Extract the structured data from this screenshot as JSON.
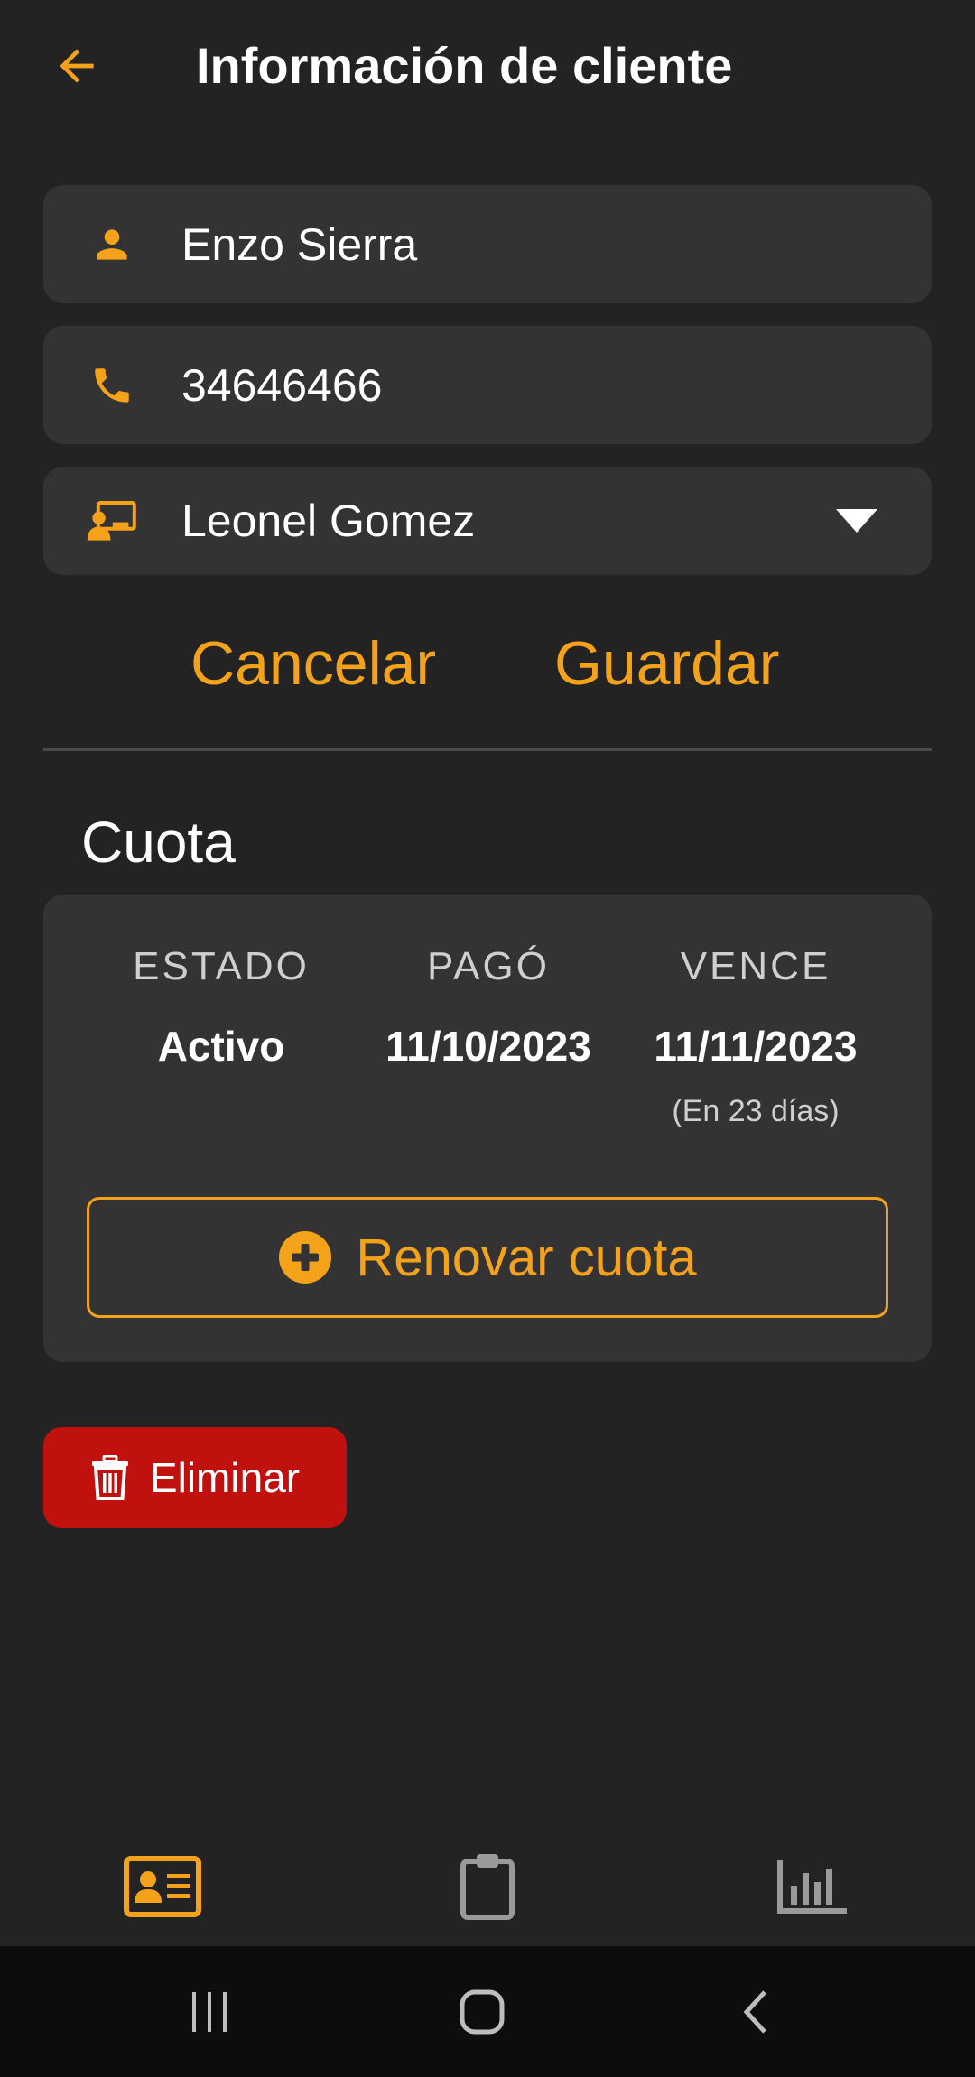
{
  "header": {
    "title": "Información de cliente",
    "back_icon": "arrow-left-icon"
  },
  "form": {
    "name": {
      "icon": "person-icon",
      "value": "Enzo Sierra"
    },
    "phone": {
      "icon": "phone-icon",
      "value": "34646466"
    },
    "trainer": {
      "icon": "trainer-icon",
      "selected": "Leonel Gomez"
    }
  },
  "actions": {
    "cancel_label": "Cancelar",
    "save_label": "Guardar"
  },
  "cuota": {
    "title": "Cuota",
    "estado_header": "ESTADO",
    "pago_header": "PAGÓ",
    "vence_header": "VENCE",
    "estado_value": "Activo",
    "pago_value": "11/10/2023",
    "vence_value": "11/11/2023",
    "vence_note": "(En 23 días)",
    "renew_label": "Renovar cuota"
  },
  "delete": {
    "label": "Eliminar"
  },
  "tabs": [
    {
      "icon": "id-card-icon",
      "active": true
    },
    {
      "icon": "clipboard-icon",
      "active": false
    },
    {
      "icon": "bar-chart-icon",
      "active": false
    }
  ],
  "colors": {
    "accent": "#f5a21b",
    "background": "#232323",
    "surface": "#333333",
    "danger": "#c0110f",
    "inactive_icon": "#9a9a9a"
  }
}
